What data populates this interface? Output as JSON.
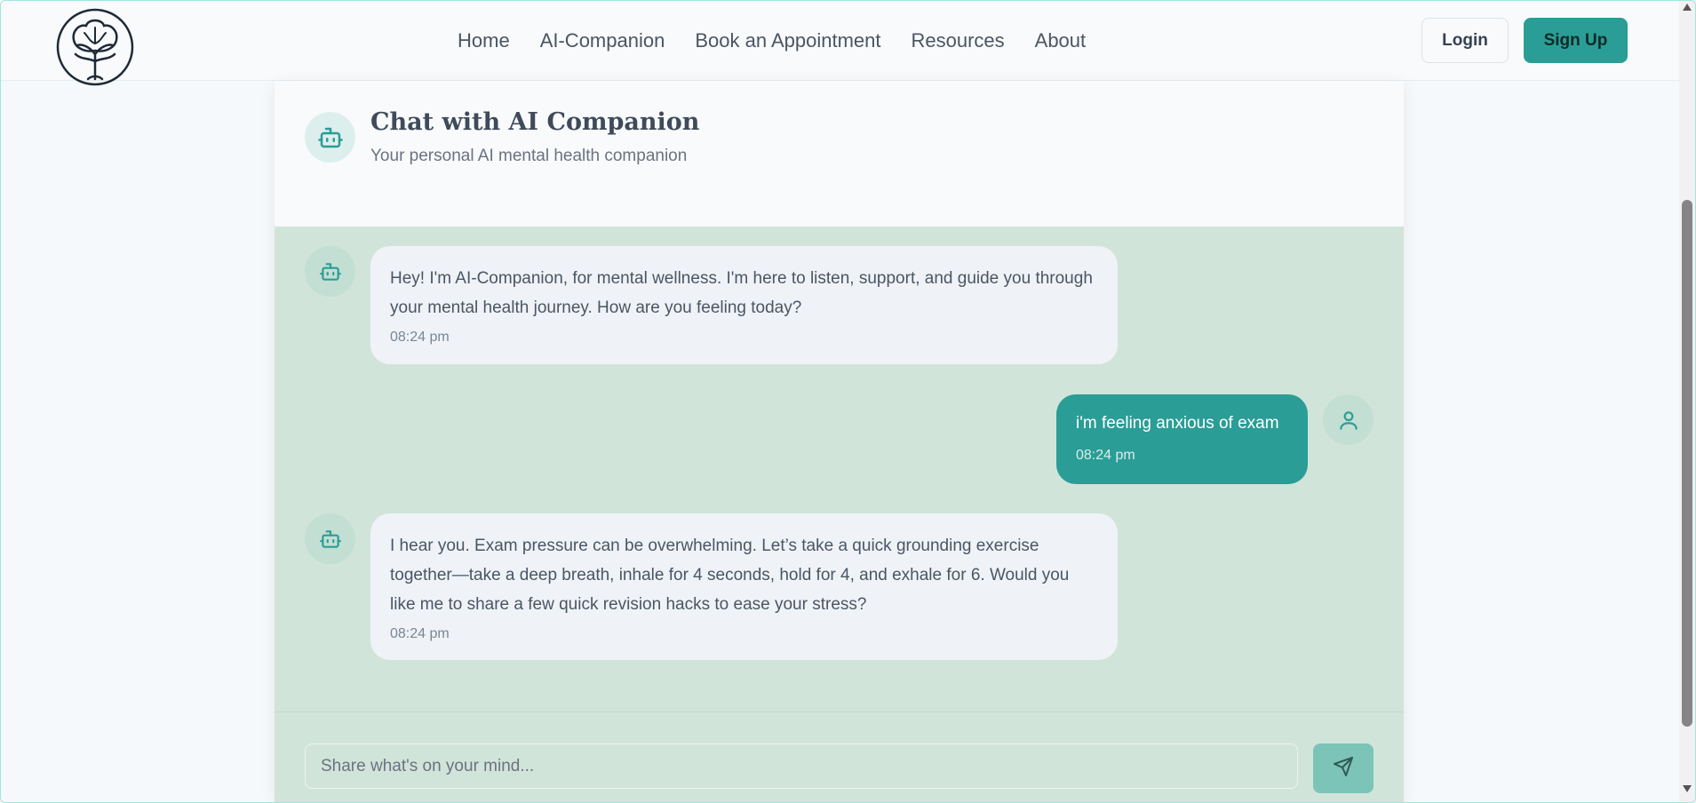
{
  "header": {
    "nav": [
      "Home",
      "AI-Companion",
      "Book an Appointment",
      "Resources",
      "About"
    ],
    "login_label": "Login",
    "signup_label": "Sign Up"
  },
  "chat": {
    "title": "Chat with AI Companion",
    "subtitle": "Your personal AI mental health companion",
    "messages": [
      {
        "role": "ai",
        "text": "Hey! I'm AI-Companion, for mental wellness. I'm here to listen, support, and guide you through your mental health journey. How are you feeling today?",
        "time": "08:24 pm"
      },
      {
        "role": "user",
        "text": "i'm feeling anxious of exam",
        "time": "08:24 pm"
      },
      {
        "role": "ai",
        "text": "I hear you. Exam pressure can be overwhelming. Let’s take a quick grounding exercise together—take a deep breath, inhale for 4 seconds, hold for 4, and exhale for 6. Would you like me to share a few quick revision hacks to ease your stress?",
        "time": "08:24 pm"
      }
    ],
    "input_placeholder": "Share what's on your mind..."
  },
  "icons": {
    "logo": "brain-tree-logo",
    "assistant": "bot-icon",
    "user": "user-icon",
    "send": "send-icon"
  },
  "colors": {
    "accent": "#2a9d96",
    "chat_background": "#d1e4d9",
    "ai_bubble": "#eff3f8",
    "send_button": "#7cc4b8"
  }
}
